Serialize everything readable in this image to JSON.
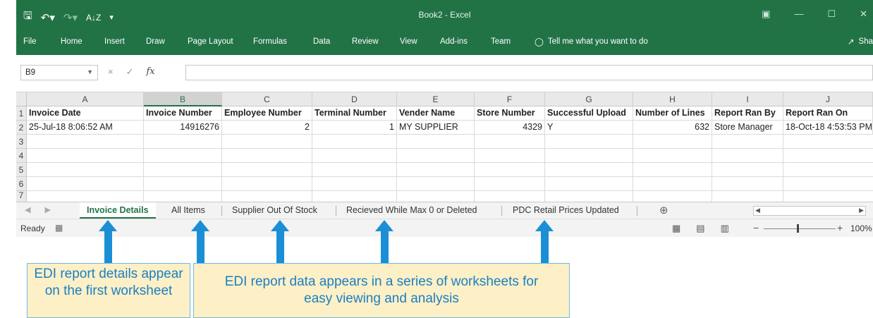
{
  "titlebar": {
    "save_icon": "save-icon",
    "undo_icon": "undo-icon",
    "redo_icon": "redo-icon",
    "sort_icon": "sort-az-icon",
    "customize_icon": "customize-qat-icon",
    "title": "Book2 - Excel",
    "ribbon_display_icon": "ribbon-display-icon",
    "minimize_icon": "minimize-icon",
    "maximize_icon": "maximize-icon",
    "close_icon": "close-icon"
  },
  "ribbon": {
    "tabs": [
      "File",
      "Home",
      "Insert",
      "Draw",
      "Page Layout",
      "Formulas",
      "Data",
      "Review",
      "View",
      "Add-ins",
      "Team"
    ],
    "tell_me": "Tell me what you want to do",
    "share": "Sha"
  },
  "formula_bar": {
    "name_box": "B9",
    "cancel_icon": "×",
    "enter_icon": "✓",
    "fx_label": "fx",
    "formula": ""
  },
  "grid": {
    "columns": [
      "A",
      "B",
      "C",
      "D",
      "E",
      "F",
      "G",
      "H",
      "I",
      "J"
    ],
    "row_numbers": [
      "1",
      "2",
      "3",
      "4",
      "5",
      "6",
      "7"
    ],
    "headers": [
      "Invoice Date",
      "Invoice Number",
      "Employee Number",
      "Terminal Number",
      "Vender Name",
      "Store Number",
      "Successful Upload",
      "Number of Lines",
      "Report Ran By",
      "Report Ran On"
    ],
    "row2": [
      "25-Jul-18 8:06:52 AM",
      "14916276",
      "2",
      "1",
      "MY SUPPLIER",
      "4329",
      "Y",
      "632",
      "Store Manager",
      "18-Oct-18 4:53:53 PM"
    ]
  },
  "sheets": {
    "tabs": [
      "Invoice Details",
      "All Items",
      "Supplier Out Of Stock",
      "Recieved While Max 0 or Deleted",
      "PDC Retail Prices Updated"
    ],
    "active": "Invoice Details"
  },
  "status": {
    "ready": "Ready",
    "zoom": "100%"
  },
  "callouts": {
    "first": "EDI report details appear on the first worksheet",
    "series": "EDI report data appears in a series of worksheets for easy viewing and analysis"
  },
  "colors": {
    "excel_green": "#217346",
    "arrow_blue": "#1b8fd6",
    "callout_fill": "#fdf0c6"
  }
}
